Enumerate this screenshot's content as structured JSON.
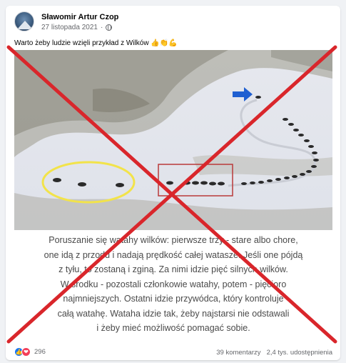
{
  "post": {
    "author": "Sławomir Artur Czop",
    "date": "27 listopada 2021",
    "separator": "·",
    "text": "Warto żeby ludzie wzięli przykład z Wilków 👍👏💪",
    "avatar_icon": "profile-avatar",
    "privacy_icon": "globe-icon"
  },
  "caption": {
    "lines": [
      "Poruszanie się watahy wilków: pierwsze trzy - stare albo chore,",
      "one idą z przodu i nadają prędkość całej watasze. Jeśli one pójdą",
      "z tyłu, to zostaną i zginą. Za nimi idzie pięć silnych wilków.",
      "W środku - pozostali członkowie watahy, potem - pięciorо",
      "najmniejszych. Ostatni idzie przywódca, który kontroluje",
      "całą watahę. Wataha idzie tak, żeby najstarsi nie odstawali",
      "i żeby mieć możliwość pomagać sobie."
    ]
  },
  "footer": {
    "reaction_count": "296",
    "comments": "39 komentarzy",
    "shares": "2,4 tys. udostępnienia",
    "reaction_icons": [
      "like-icon",
      "love-icon"
    ]
  },
  "colors": {
    "cross": "#d9262b",
    "highlight_circle": "#f2e34a",
    "highlight_rect": "#b93a3a",
    "arrow": "#1f5fd1",
    "like": "#1877f2",
    "love": "#f33e58"
  }
}
